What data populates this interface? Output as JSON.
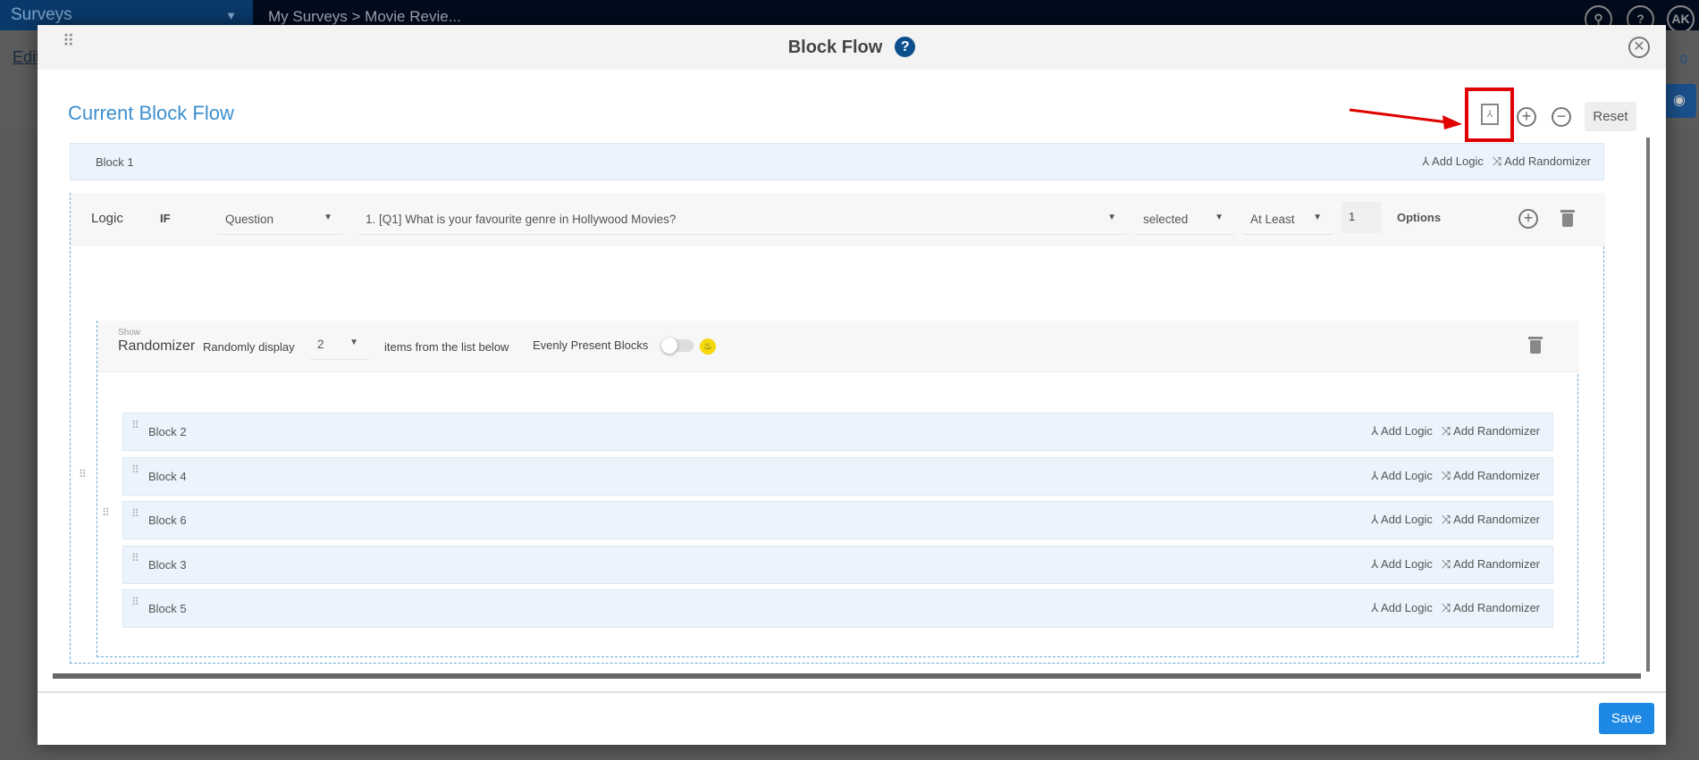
{
  "app": {
    "brand": "Surveys",
    "breadcrumb": "My Surveys  >  Movie Revie...",
    "user_initials": "AK",
    "edit_label": "Edit",
    "counter": "0"
  },
  "modal": {
    "title": "Block Flow",
    "help": "?",
    "section_title": "Current Block Flow",
    "reset_label": "Reset",
    "save_label": "Save"
  },
  "block1": {
    "name": "Block 1",
    "add_logic": "Add Logic",
    "add_randomizer": "Add Randomizer"
  },
  "logic": {
    "label": "Logic",
    "if": "IF",
    "type": "Question",
    "question": "1. [Q1] What is your favourite genre in Hollywood Movies?",
    "condition": "selected",
    "quantifier": "At Least",
    "count": "1",
    "options_label": "Options"
  },
  "randomizer": {
    "show": "Show",
    "label": "Randomizer",
    "randomly_display": "Randomly display",
    "count": "2",
    "items_text": "items from the list below",
    "evenly": "Evenly Present Blocks",
    "evenly_on": false
  },
  "blocks": [
    {
      "name": "Block 2",
      "add_logic": "Add Logic",
      "add_randomizer": "Add Randomizer"
    },
    {
      "name": "Block 4",
      "add_logic": "Add Logic",
      "add_randomizer": "Add Randomizer"
    },
    {
      "name": "Block 6",
      "add_logic": "Add Logic",
      "add_randomizer": "Add Randomizer"
    },
    {
      "name": "Block 3",
      "add_logic": "Add Logic",
      "add_randomizer": "Add Randomizer"
    },
    {
      "name": "Block 5",
      "add_logic": "Add Logic",
      "add_randomizer": "Add Randomizer"
    }
  ],
  "colors": {
    "accent": "#1e88e5",
    "title": "#3b8fcf",
    "highlight": "#e00000"
  }
}
